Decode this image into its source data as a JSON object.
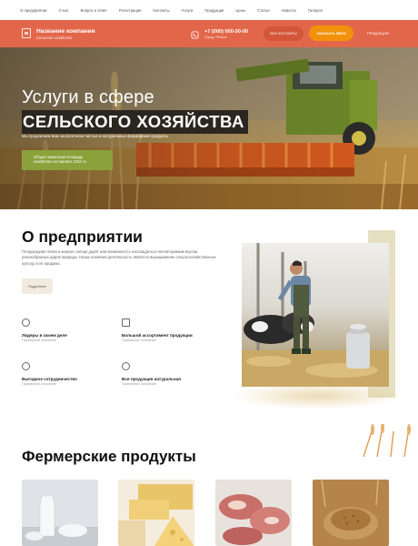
{
  "topnav": [
    "О предприятии",
    "О нас",
    "Вопрос и ответ",
    "Регистрация",
    "Контакты",
    "Услуги",
    "Продукция",
    "Цены",
    "Статьи",
    "Новости",
    "Галерея"
  ],
  "header": {
    "company_name": "Название компании",
    "company_sub": "Сельское хозяйство",
    "phone": "+7 (000) 000-00-00",
    "city": "Город, Регион",
    "contacts_button": "ВСЕ КОНТАКТЫ",
    "call_button": "ЗАКАЗАТЬ ЗВОН",
    "products_link": "ПРОДУКЦИЯ"
  },
  "hero": {
    "title_line1": "Услуги в сфере",
    "title_line2": "СЕЛЬСКОГО ХОЗЯЙСТВА",
    "subtitle": "Мы предлагаем Вам экологически чистые и натуральные фермерские продукты",
    "badge": "Общая земельная площадь хозяйства составляет 1034 га"
  },
  "about": {
    "title": "О предприятии",
    "text": "Плодородная почва и жаркое солнце дарят нам возможность наслаждаться неповторимым вкусом разнообразных даров природы. Наша основная деятельность является выращивание сельскохозяйственных культур и их продажа.",
    "more_button": "Подробнее",
    "features": [
      {
        "title": "Лидеры в своем деле",
        "desc": "Примерное описание"
      },
      {
        "title": "Большой ассортимент продукции",
        "desc": "Примерное описание"
      },
      {
        "title": "Выгодное сотрудничество",
        "desc": "Примерное описание"
      },
      {
        "title": "Вся продукция натуральная",
        "desc": "Примерное описание"
      }
    ]
  },
  "products": {
    "title": "Фермерские продукты"
  },
  "colors": {
    "header": "#e2674a",
    "accent": "#f2920c",
    "badge": "#8aa23a"
  }
}
